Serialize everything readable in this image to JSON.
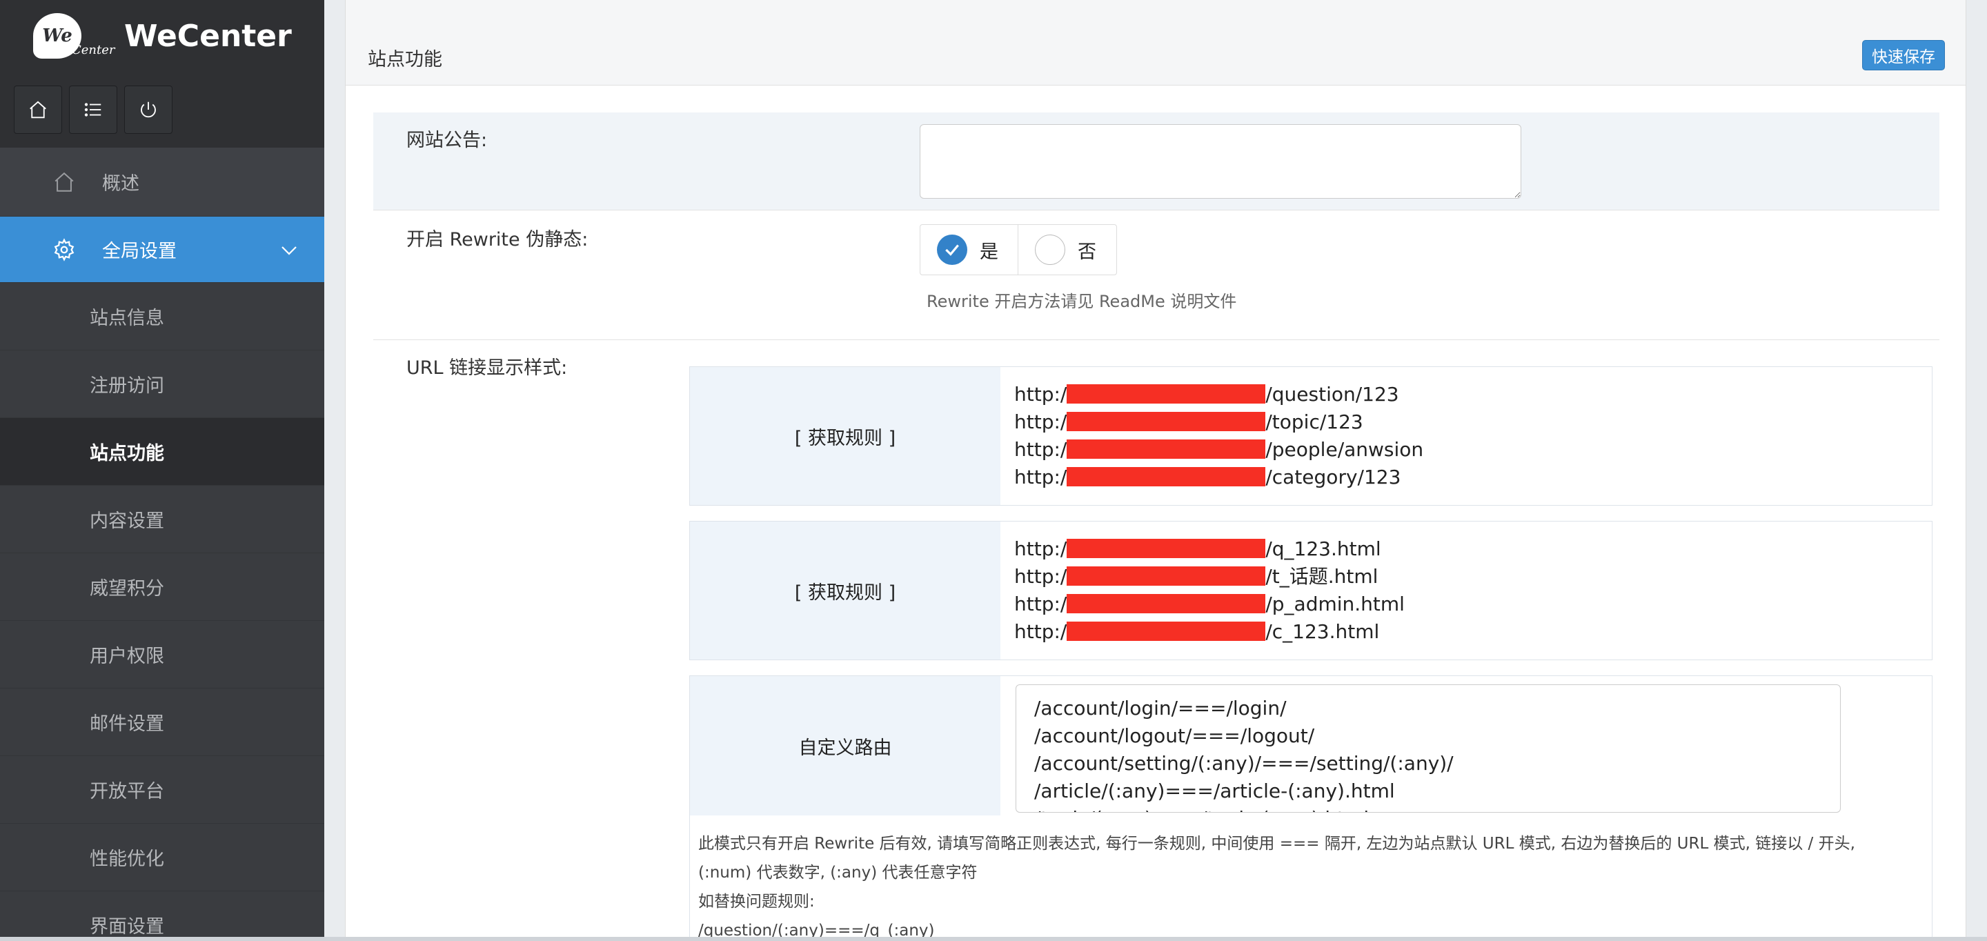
{
  "brand": {
    "logo": "We",
    "logo_sub": "Center",
    "name": "WeCenter"
  },
  "quickbar": {
    "home_icon": "home-icon",
    "list_icon": "list-icon",
    "power_icon": "power-icon"
  },
  "nav": {
    "overview": "概述",
    "global": "全局设置",
    "subs": [
      "站点信息",
      "注册访问",
      "站点功能",
      "内容设置",
      "威望积分",
      "用户权限",
      "邮件设置",
      "开放平台",
      "性能优化",
      "界面设置"
    ],
    "active_index": 2
  },
  "panel": {
    "title": "站点功能",
    "save_label": "快速保存"
  },
  "announce": {
    "label": "网站公告:",
    "value": ""
  },
  "rewrite": {
    "label": "开启 Rewrite 伪静态:",
    "yes": "是",
    "no": "否",
    "selected": "yes",
    "hint": "Rewrite 开启方法请见 ReadMe 说明文件"
  },
  "url_style": {
    "label": "URL 链接显示样式:",
    "box1": {
      "button": "[ 获取规则 ]",
      "prefix": "http:/",
      "suffixes": [
        "/question/123",
        "/topic/123",
        "/people/anwsion",
        "/category/123"
      ]
    },
    "box2": {
      "button": "[ 获取规则 ]",
      "prefix": "http:/",
      "suffixes": [
        "/q_123.html",
        "/t_话题.html",
        "/p_admin.html",
        "/c_123.html"
      ]
    },
    "box3": {
      "button": "自定义路由",
      "routes": [
        "/account/login/===/login/",
        "/account/logout/===/logout/",
        "/account/setting/(:any)/===/setting/(:any)/",
        "/article/(:any)===/article-(:any).html",
        "/topic/(:any)===/topic-(:any).html"
      ],
      "desc": [
        "此模式只有开启 Rewrite 后有效, 请填写简略正则表达式, 每行一条规则, 中间使用 === 隔开, 左边为站点默认 URL 模式, 右边为替换后的 URL 模式, 链接以 / 开头,",
        "(:num) 代表数字, (:any) 代表任意字符",
        "如替换问题规则:",
        "/question/(:any)===/q_(:any)"
      ]
    }
  }
}
